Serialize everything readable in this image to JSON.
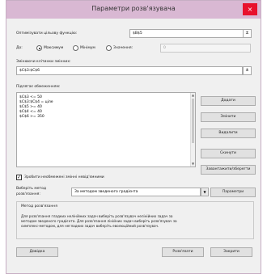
{
  "window": {
    "title": "Параметри розв'язувача",
    "close_glyph": "×"
  },
  "objective": {
    "label": "Оптимізувати цільову функцію:",
    "value": "$B$5",
    "picker_glyph": "±"
  },
  "to": {
    "label": "До:",
    "options": [
      {
        "label": "Максимум",
        "checked": true
      },
      {
        "label": "Мінімум",
        "checked": false
      },
      {
        "label": "Значення:",
        "checked": false
      }
    ],
    "value": "0"
  },
  "variables": {
    "label": "Змінюючи клітинки змінних:",
    "value": "$C$3:$C$6",
    "picker_glyph": "±"
  },
  "constraints": {
    "label": "Підлягає обмеженням:",
    "items": [
      "$C$3 <= 50",
      "$C$3:$C$4 = ціле",
      "$C$5 >= 40",
      "$C$4 <= 40",
      "$C$6 >= 350"
    ],
    "scroll_up": "▲",
    "scroll_down": "▼"
  },
  "side_buttons": {
    "add": "Додати",
    "change": "Змінити",
    "delete": "Видалити",
    "reset": "Скинути",
    "load_save": "Завантажити/зберегти"
  },
  "nonnegative": {
    "checked": true,
    "check_glyph": "✓",
    "label": "Зробити необмежені змінні невід'ємними"
  },
  "method": {
    "label_line1": "Виберіть метод",
    "label_line2": "розв'язання:",
    "value": "За методом зведеного градієнта",
    "arrow": "▼",
    "params_button": "Параметри"
  },
  "method_group": {
    "title": "Метод розв'язання",
    "lines": [
      "Для розв'язання гладких нелінійних задач виберіть розв'язувач нелінійних задач за",
      "методом зведеного градієнта. Для розв'язання лінійних задач виберіть розв'язувач за",
      "симплекс-методом, для негладких задач виберіть еволюційний розв'язувач."
    ]
  },
  "footer": {
    "help": "Довідка",
    "solve": "Розв'язати",
    "close": "Закрити"
  }
}
